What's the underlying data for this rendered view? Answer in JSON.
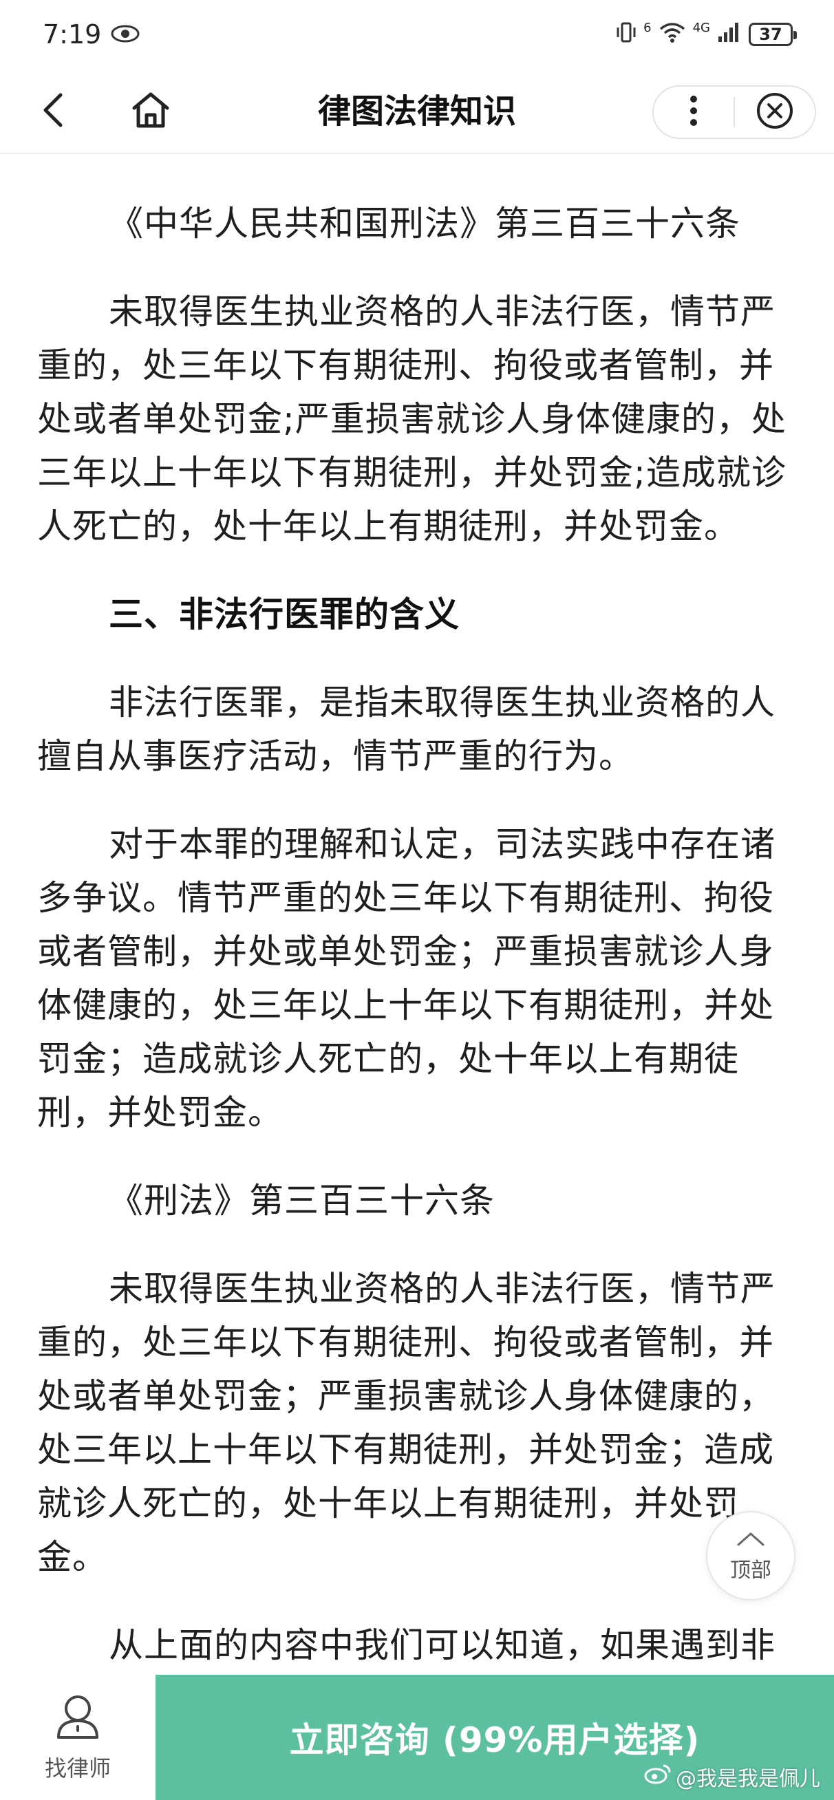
{
  "status_bar": {
    "time": "7:19",
    "network": "4G",
    "sim": "6",
    "battery": "37"
  },
  "nav": {
    "title": "律图法律知识",
    "icons": {
      "back": "chevron-left-icon",
      "home": "home-icon",
      "more": "more-vertical-icon",
      "close": "close-circle-icon"
    }
  },
  "article": {
    "paragraphs": [
      {
        "type": "text",
        "text": "十年以上有期徒刑，并处罚金。"
      },
      {
        "type": "title",
        "text": "《中华人民共和国刑法》第三百三十六条"
      },
      {
        "type": "text",
        "text": "未取得医生执业资格的人非法行医，情节严重的，处三年以下有期徒刑、拘役或者管制，并处或者单处罚金;严重损害就诊人身体健康的，处三年以上十年以下有期徒刑，并处罚金;造成就诊人死亡的，处十年以上有期徒刑，并处罚金。"
      },
      {
        "type": "heading",
        "text": "三、非法行医罪的含义"
      },
      {
        "type": "text",
        "text": "非法行医罪，是指未取得医生执业资格的人擅自从事医疗活动，情节严重的行为。"
      },
      {
        "type": "text",
        "text": "对于本罪的理解和认定，司法实践中存在诸多争议。情节严重的处三年以下有期徒刑、拘役或者管制，并处或单处罚金；严重损害就诊人身体健康的，处三年以上十年以下有期徒刑，并处罚金；造成就诊人死亡的，处十年以上有期徒刑，并处罚金。"
      },
      {
        "type": "title",
        "text": "《刑法》第三百三十六条"
      },
      {
        "type": "text",
        "text": "未取得医生执业资格的人非法行医，情节严重的，处三年以下有期徒刑、拘役或者管制，并处或者单处罚金；严重损害就诊人身体健康的，处三年以上十年以下有期徒刑，并处罚金；造成就诊人死亡的，处十年以上有期徒刑，并处罚金。"
      },
      {
        "type": "text",
        "text": "从上面的内容中我们可以知道，如果遇到非"
      }
    ]
  },
  "back_to_top": {
    "label": "顶部",
    "icon": "chevron-up-icon"
  },
  "bottom_bar": {
    "find_lawyer_label": "找律师",
    "find_lawyer_icon": "lawyer-icon",
    "consult_label": "立即咨询 (99%用户选择)",
    "accent_color": "#5cbf9f"
  },
  "watermark": {
    "text": "@我是我是佩儿",
    "icon": "weibo-icon"
  }
}
